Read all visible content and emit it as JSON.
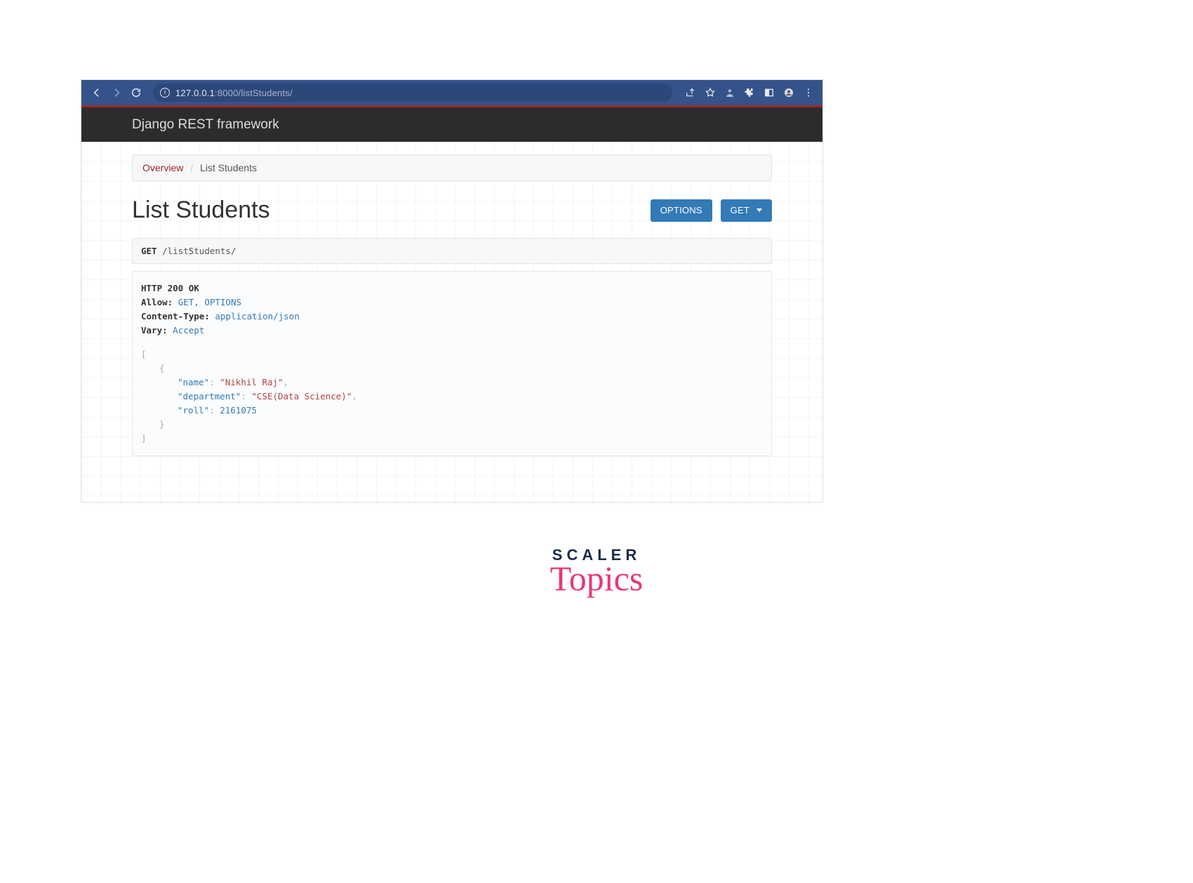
{
  "browser": {
    "url_host": "127.0.0.1",
    "url_port_path": ":8000/listStudents/"
  },
  "framework": {
    "title": "Django REST framework"
  },
  "breadcrumb": {
    "root": "Overview",
    "separator": "/",
    "current": "List Students"
  },
  "page": {
    "title": "List Students"
  },
  "buttons": {
    "options": "OPTIONS",
    "get": "GET"
  },
  "request": {
    "method": "GET",
    "path": "/listStudents/"
  },
  "response": {
    "status_line": "HTTP 200 OK",
    "headers": {
      "allow_label": "Allow:",
      "allow_value": "GET, OPTIONS",
      "content_type_label": "Content-Type:",
      "content_type_value": "application/json",
      "vary_label": "Vary:",
      "vary_value": "Accept"
    },
    "body": [
      {
        "name_key": "\"name\"",
        "name_val": "\"Nikhil Raj\"",
        "dept_key": "\"department\"",
        "dept_val": "\"CSE(Data Science)\"",
        "roll_key": "\"roll\"",
        "roll_val": "2161075"
      }
    ]
  },
  "logo": {
    "line1": "SCALER",
    "line2": "Topics"
  }
}
